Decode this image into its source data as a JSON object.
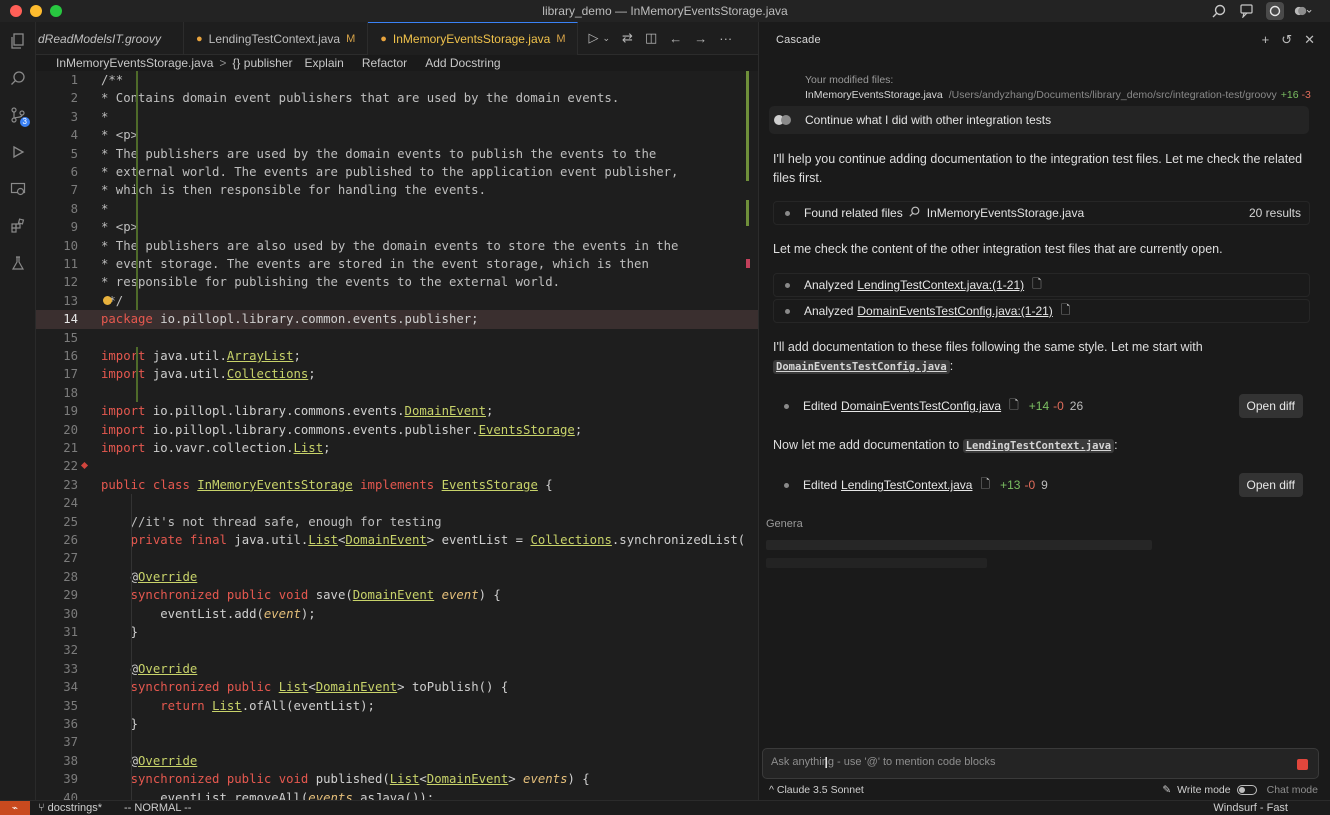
{
  "window": {
    "title": "library_demo — InMemoryEventsStorage.java"
  },
  "tabs": [
    {
      "label": "dReadModelsIT.groovy",
      "modified": ""
    },
    {
      "label": "LendingTestContext.java",
      "modified": "M"
    },
    {
      "label": "InMemoryEventsStorage.java",
      "modified": "M"
    }
  ],
  "breadcrumb": {
    "file": "InMemoryEventsStorage.java",
    "sep": ">",
    "symbol": "{} publisher",
    "actions": [
      "Explain",
      "Refactor",
      "Add Docstring"
    ]
  },
  "editor": {
    "lines": [
      {
        "n": "1",
        "t": "/**"
      },
      {
        "n": "2",
        "t": "* Contains domain event publishers that are used by the domain events."
      },
      {
        "n": "3",
        "t": "*"
      },
      {
        "n": "4",
        "t": "* <p>"
      },
      {
        "n": "5",
        "t": "* The publishers are used by the domain events to publish the events to the"
      },
      {
        "n": "6",
        "t": "* external world. The events are published to the application event publisher,"
      },
      {
        "n": "7",
        "t": "* which is then responsible for handling the events."
      },
      {
        "n": "8",
        "t": "*"
      },
      {
        "n": "9",
        "t": "* <p>"
      },
      {
        "n": "10",
        "t": "* The publishers are also used by the domain events to store the events in the"
      },
      {
        "n": "11",
        "t": "* event storage. The events are stored in the event storage, which is then"
      },
      {
        "n": "12",
        "t": "* responsible for publishing the events to the external world."
      },
      {
        "n": "13",
        "t": " */"
      },
      {
        "n": "14",
        "t": "package io.pillopl.library.common.events.publisher;"
      },
      {
        "n": "15",
        "t": ""
      },
      {
        "n": "16",
        "t": "import java.util.ArrayList;"
      },
      {
        "n": "17",
        "t": "import java.util.Collections;"
      },
      {
        "n": "18",
        "t": ""
      },
      {
        "n": "19",
        "t": "import io.pillopl.library.commons.events.DomainEvent;"
      },
      {
        "n": "20",
        "t": "import io.pillopl.library.commons.events.publisher.EventsStorage;"
      },
      {
        "n": "21",
        "t": "import io.vavr.collection.List;"
      },
      {
        "n": "22",
        "t": ""
      },
      {
        "n": "23",
        "t": "public class InMemoryEventsStorage implements EventsStorage {"
      },
      {
        "n": "24",
        "t": ""
      },
      {
        "n": "25",
        "t": "    //it's not thread safe, enough for testing"
      },
      {
        "n": "26",
        "t": "    private final java.util.List<DomainEvent> eventList = Collections.synchronizedList("
      },
      {
        "n": "27",
        "t": ""
      },
      {
        "n": "28",
        "t": "    @Override"
      },
      {
        "n": "29",
        "t": "    synchronized public void save(DomainEvent event) {"
      },
      {
        "n": "30",
        "t": "        eventList.add(event);"
      },
      {
        "n": "31",
        "t": "    }"
      },
      {
        "n": "32",
        "t": ""
      },
      {
        "n": "33",
        "t": "    @Override"
      },
      {
        "n": "34",
        "t": "    synchronized public List<DomainEvent> toPublish() {"
      },
      {
        "n": "35",
        "t": "        return List.ofAll(eventList);"
      },
      {
        "n": "36",
        "t": "    }"
      },
      {
        "n": "37",
        "t": ""
      },
      {
        "n": "38",
        "t": "    @Override"
      },
      {
        "n": "39",
        "t": "    synchronized public void published(List<DomainEvent> events) {"
      },
      {
        "n": "40",
        "t": "        eventList.removeAll(events.asJava());"
      }
    ]
  },
  "status": {
    "branch": "docstrings*",
    "mode": "-- NORMAL --",
    "right": "Windsurf - Fast"
  },
  "cascade": {
    "title": "Cascade",
    "modified_label": "Your modified files:",
    "modified_file": "InMemoryEventsStorage.java",
    "modified_path": "/Users/andyzhang/Documents/library_demo/src/integration-test/groovy",
    "modified_add": "+16",
    "modified_del": "-3",
    "user_message": "Continue what I did with other integration tests",
    "p1": "I'll help you continue adding documentation to the integration test files. Let me check the related files first.",
    "step_found_label": "Found related files",
    "step_found_query": "InMemoryEventsStorage.java",
    "step_found_count": "20 results",
    "p2": "Let me check the content of the other integration test files that are currently open.",
    "step_an1_label": "Analyzed",
    "step_an1_link": "LendingTestContext.java:(1-21)",
    "step_an2_label": "Analyzed",
    "step_an2_link": "DomainEventsTestConfig.java:(1-21)",
    "p3a": "I'll add documentation to these files following the same style. Let me start with",
    "p3chip": "DomainEventsTestConfig.java",
    "p3b": ":",
    "step_ed1_label": "Edited",
    "step_ed1_link": "DomainEventsTestConfig.java",
    "step_ed1_add": "+14",
    "step_ed1_del": "-0",
    "step_ed1_lines": "26",
    "p4a": "Now let me add documentation to",
    "p4chip": "LendingTestContext.java",
    "p4b": ":",
    "step_ed2_label": "Edited",
    "step_ed2_link": "LendingTestContext.java",
    "step_ed2_add": "+13",
    "step_ed2_del": "-0",
    "step_ed2_lines": "9",
    "open_diff": "Open diff",
    "generating": "Genera",
    "input_placeholder": "Ask anything - use '@' to mention code blocks",
    "model": "Claude 3.5 Sonnet",
    "write_mode": "Write mode",
    "chat_mode": "Chat mode"
  }
}
